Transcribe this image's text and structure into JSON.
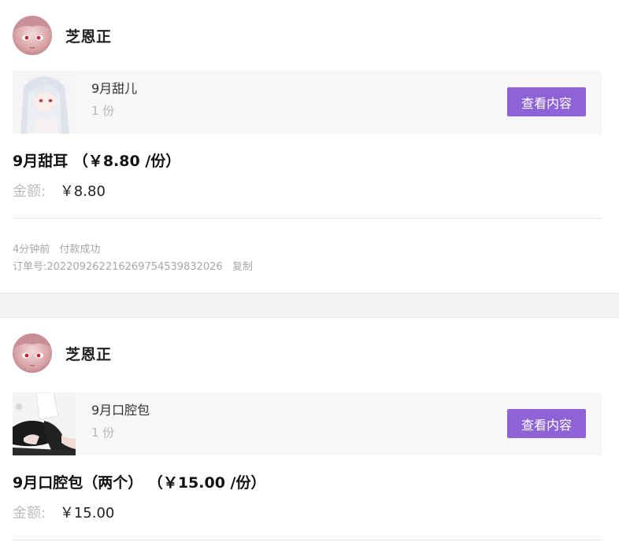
{
  "orders": [
    {
      "seller_name": "芝恩正",
      "product_name": "9月甜儿",
      "product_qty": "1 份",
      "view_button_label": "查看内容",
      "order_title": "9月甜耳 （￥8.80 /份）",
      "amount_label": "金额:",
      "amount_value": "￥8.80",
      "time_ago": "4分钟前",
      "status": "付款成功",
      "order_number_label": "订单号:",
      "order_number": "202209262216269754539832026",
      "copy_label": "复制"
    },
    {
      "seller_name": "芝恩正",
      "product_name": "9月口腔包",
      "product_qty": "1 份",
      "view_button_label": "查看内容",
      "order_title": "9月口腔包（两个） （￥15.00 /份）",
      "amount_label": "金额:",
      "amount_value": "￥15.00"
    }
  ],
  "colors": {
    "accent_button": "#8e63d8",
    "muted_text": "#b5b5b5",
    "panel_bg": "#f7f7f7"
  },
  "icons": {
    "avatar": "avatar-image",
    "product_thumb": "product-thumbnail-image"
  }
}
